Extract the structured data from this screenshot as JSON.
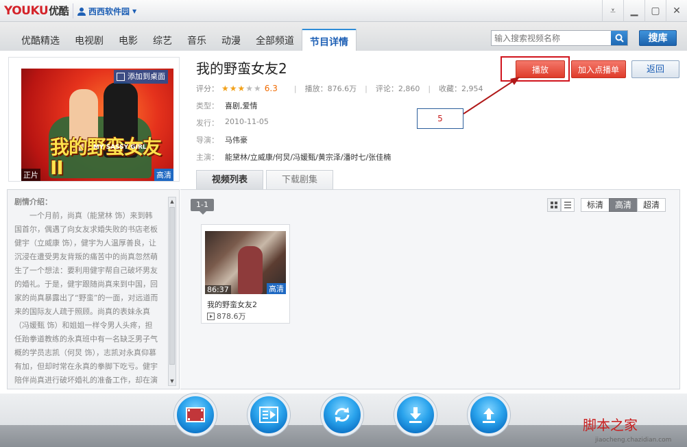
{
  "app": {
    "logo_you": "YOUKU",
    "logo_cn": "优酷",
    "user": "西西软件园"
  },
  "nav": {
    "tabs": [
      "优酷精选",
      "电视剧",
      "电影",
      "综艺",
      "音乐",
      "动漫",
      "全部频道",
      "节目详情"
    ],
    "active_tab": "节目详情",
    "search_placeholder": "输入搜索视频名称",
    "search_button": "搜库"
  },
  "poster": {
    "add_desktop": "添加到桌面",
    "tag_left": "正片",
    "tag_right": "高清",
    "title_art": "我的野蛮女友II",
    "title_en": "MY SASSY GIRL"
  },
  "detail": {
    "title": "我的野蛮女友2",
    "rating_label": "评分：",
    "rating_stars": 3,
    "rating_score": "6.3",
    "plays": "播放：876.6万",
    "comments": "评论：2,860",
    "favorites": "收藏：2,954",
    "type_label": "类型：",
    "type_value": "喜剧,爱情",
    "release_label": "发行：",
    "release_value": "2010-11-05",
    "director_label": "导演：",
    "director_value": "马伟豪",
    "cast_label": "主演：",
    "cast_value": "能黛林/立威康/何炅/冯媛甄/黄宗泽/潘时七/张佳楠"
  },
  "actions": {
    "play": "播放",
    "add_playlist": "加入点播单",
    "back": "返回"
  },
  "callout": "5",
  "content_tabs": [
    "视频列表",
    "下载剧集"
  ],
  "synopsis": {
    "label": "剧情介绍：",
    "text": "一个月前，尚真（能黛林 饰）来到韩国首尔，偶遇了向女友求婚失败的书店老板健宇（立威康 饰），健宇为人温厚善良，让沉浸在遭受男友背叛的痛苦中的尚真忽然萌生了一个想法：要利用健宇帮自己破坏男友的婚礼。于是，健宇跟随尚真来到中国，回家的尚真暴露出了“野蛮”的一面，对远道而来的国际友人疏于照顾。尚真的表妹永真（冯媛甄 饰）和姐姐一样令男人头疼，担任跆拳道教练的永真班中有一名缺乏男子气概的学员志凯（何炅 饰），志凯对永真仰慕有加，但却时常在永真的拳脚下吃亏。健宇陪伴尚真进行破坏婚礼的准备工作，却在演习中得罪陌生人，"
  },
  "list": {
    "range": "1-1",
    "quality": [
      "标清",
      "高清",
      "超清"
    ],
    "active_quality": "高清",
    "items": [
      {
        "duration": "86:37",
        "hd": "高清",
        "title": "我的野蛮女友2",
        "plays": "878.6万"
      }
    ]
  },
  "watermark": {
    "main": "脚本之家",
    "sub": "jiaocheng.chazidian.com"
  },
  "colors": {
    "accent": "#1d5fb5",
    "play_red": "#df3b2a",
    "star": "#f2a11a",
    "score": "#f06a00"
  }
}
